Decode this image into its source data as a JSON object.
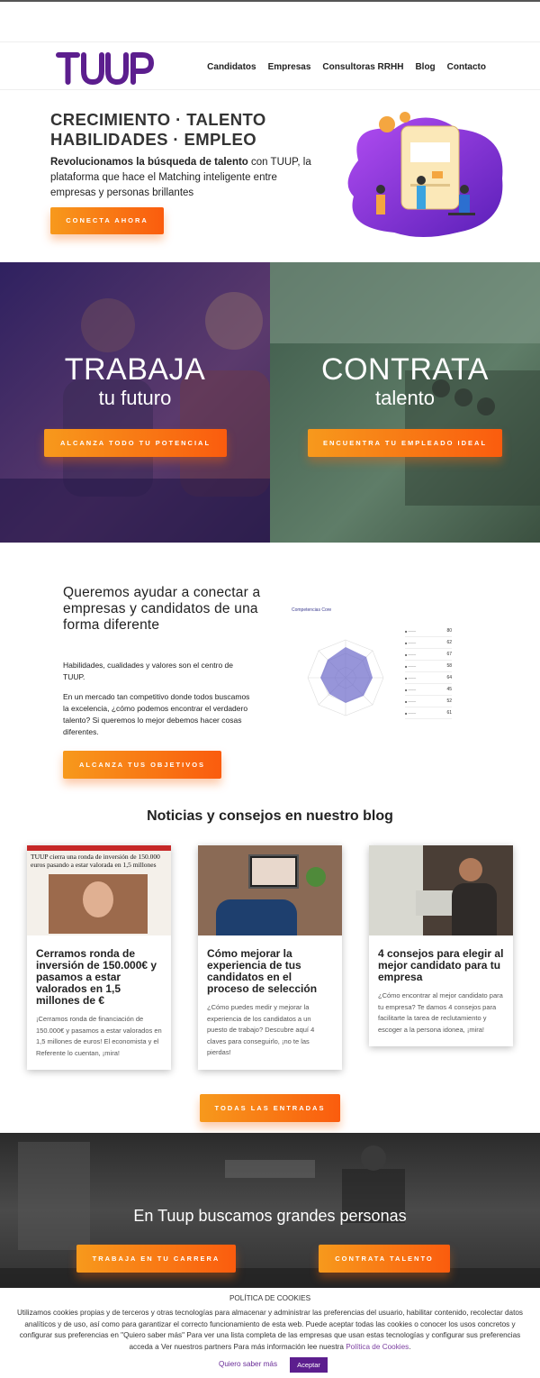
{
  "header": {
    "logo_text": "TUUP",
    "nav": [
      "Candidatos",
      "Empresas",
      "Consultoras RRHH",
      "Blog",
      "Contacto"
    ]
  },
  "hero": {
    "line1": "CRECIMIENTO · TALENTO",
    "line2": "HABILIDADES · EMPLEO",
    "desc_bold": "Revolucionamos la búsqueda de talento",
    "desc_rest": " con TUUP, la plataforma que hace el Matching inteligente entre empresas y personas brillantes",
    "cta": "CONECTA AHORA"
  },
  "split": {
    "left": {
      "big": "TRABAJA",
      "sub": "tu futuro",
      "cta": "ALCANZA TODO TU POTENCIAL"
    },
    "right": {
      "big": "CONTRATA",
      "sub": "talento",
      "cta": "ENCUENTRA TU EMPLEADO IDEAL"
    }
  },
  "about": {
    "title": "Queremos ayudar a conectar a empresas y candidatos de una forma diferente",
    "p1": "Habilidades, cualidades y valores son el centro de TUUP.",
    "p2": "En un mercado tan competitivo donde todos buscamos la excelencia, ¿cómo podemos encontrar el verdadero talento? Si queremos lo mejor debemos hacer cosas diferentes.",
    "cta": "ALCANZA TUS OBJETIVOS"
  },
  "competencias": {
    "title": "Competencias Core",
    "values": [
      80,
      62,
      67,
      58,
      64,
      45,
      52,
      61
    ]
  },
  "blog": {
    "title": "Noticias y consejos en nuestro blog",
    "cards": [
      {
        "newspaper_headline": "TUUP cierra una ronda de inversión de 150.000 euros pasando a estar valorada en 1,5 millones",
        "title": "Cerramos ronda de inversión de 150.000€ y pasamos a estar valorados en 1,5 millones de €",
        "excerpt": "¡Cerramos ronda de financiación de 150.000€ y pasamos a estar valorados en 1,5 millones de euros! El economista y el Referente lo cuentan, ¡mira!"
      },
      {
        "title": "Cómo mejorar la experiencia de tus candidatos en el proceso de selección",
        "excerpt": "¿Cómo puedes medir y mejorar la experiencia de los candidatos a un puesto de trabajo? Descubre aquí 4 claves para conseguirlo, ¡no te las pierdas!"
      },
      {
        "title": "4 consejos para elegir al mejor candidato para tu empresa",
        "excerpt": "¿Cómo encontrar al mejor candidato para tu empresa? Te damos 4 consejos para facilitarte la tarea de reclutamiento y escoger a la persona idonea, ¡mira!"
      }
    ],
    "all_cta": "TODAS LAS ENTRADAS"
  },
  "cta_band": {
    "title": "En Tuup buscamos grandes personas",
    "btn1": "TRABAJA EN TU CARRERA",
    "btn2": "CONTRATA TALENTO"
  },
  "cookies": {
    "title": "POLÍTICA DE COOKIES",
    "body": "Utilizamos cookies propias y de terceros y otras tecnologías para almacenar y administrar las preferencias del usuario, habilitar contenido, recolectar datos analíticos y de uso, así como para garantizar el correcto funcionamiento de esta web. Puede aceptar todas las cookies o conocer los usos concretos y configurar sus preferencias en \"Quiero saber más\" Para ver una lista completa de las empresas que usan estas tecnologías y configurar sus preferencias acceda a Ver nuestros partners Para más información lee nuestra ",
    "link": "Política de Cookies",
    "end": ".",
    "more": "Quiero saber más",
    "accept": "Aceptar"
  },
  "colors": {
    "brand_purple": "#5c1e8e",
    "accent_orange": "#fa5c0e"
  }
}
